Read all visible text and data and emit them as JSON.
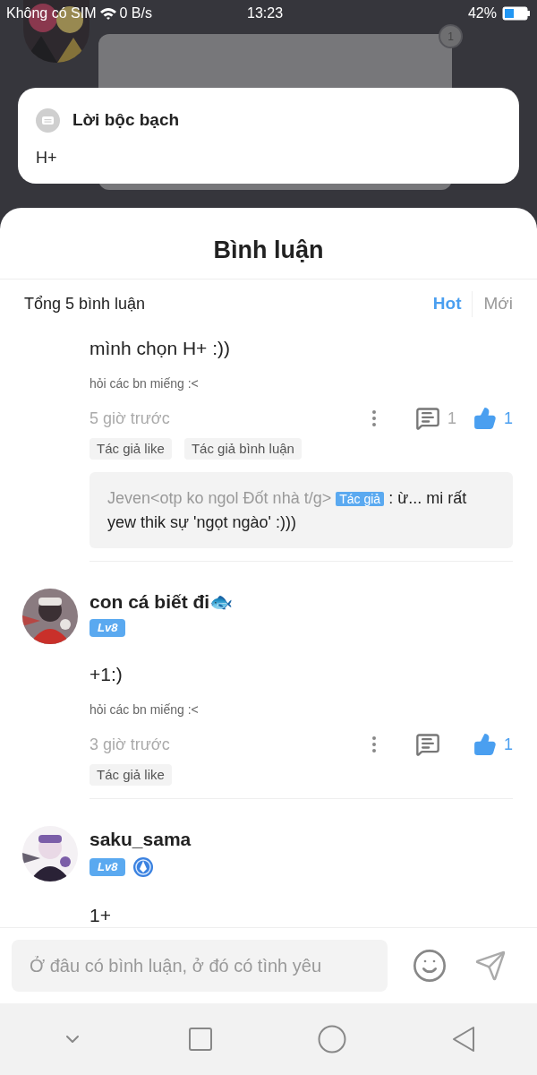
{
  "status_bar": {
    "carrier": "Không có SIM",
    "speed": "0 B/s",
    "time": "13:23",
    "battery": "42%"
  },
  "background": {
    "badge": "1"
  },
  "confession": {
    "title": "Lời bộc bạch",
    "text": "H+"
  },
  "sheet": {
    "title": "Bình luận",
    "total": "Tổng 5 bình luận",
    "sort_tabs": [
      {
        "label": "Hot",
        "selected": true
      },
      {
        "label": "Mới",
        "selected": false
      }
    ],
    "comments": [
      {
        "text": "mình chọn H+ :))",
        "note": "hỏi các bn miếng :<",
        "time": "5 giờ trước",
        "replies": "1",
        "likes": "1",
        "liked": true,
        "tags": [
          "Tác giả like",
          "Tác giả bình luận"
        ],
        "reply": {
          "author": "Jeven<otp ko ngol Đốt nhà t/g>",
          "author_tag": "Tác giả",
          "text": ": ừ... mi rất yew thik sự 'ngọt ngào' :)))"
        }
      },
      {
        "author": "con cá biết đi🐟",
        "level": "Lv8",
        "verified": false,
        "text": "+1:)",
        "note": "hỏi các bn miếng :<",
        "time": "3 giờ trước",
        "likes": "1",
        "liked": true,
        "tags": [
          "Tác giả like"
        ]
      },
      {
        "author": "saku_sama",
        "level": "Lv8",
        "verified": true,
        "text": "1+"
      }
    ]
  },
  "composer": {
    "placeholder": "Ở đâu có bình luận, ở đó có tình yêu"
  }
}
